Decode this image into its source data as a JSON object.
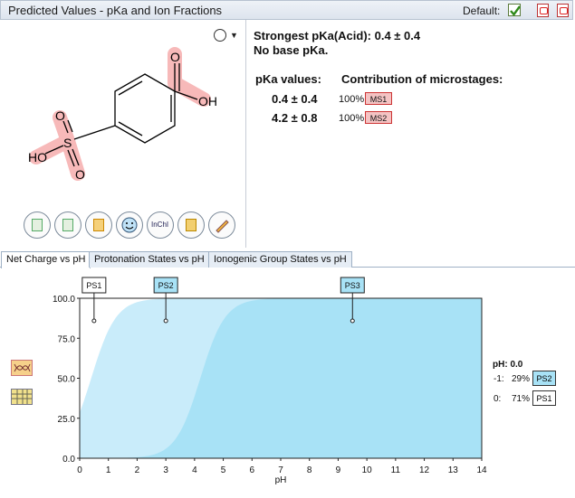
{
  "window": {
    "title": "Predicted Values - pKa and Ion Fractions",
    "default_label": "Default:",
    "default_checked": true
  },
  "molecule": {
    "atoms": [
      "O",
      "OH",
      "HO",
      "S",
      "O",
      "O"
    ],
    "highlight_color": "#f7b9b9",
    "toolbar_buttons": [
      "copy-structure",
      "copy-image",
      "edit-structure",
      "smiley",
      "InChI",
      "open",
      "pencil"
    ],
    "inchi_label": "InChI"
  },
  "pka": {
    "strongest": "Strongest pKa(Acid): 0.4 ± 0.4",
    "no_base": "No base pKa.",
    "header_values": "pKa values:",
    "header_contrib": "Contribution of microstages:",
    "rows": [
      {
        "value": "0.4 ± 0.4",
        "percent": "100%",
        "ms": "MS1"
      },
      {
        "value": "4.2 ± 0.8",
        "percent": "100%",
        "ms": "MS2"
      }
    ]
  },
  "tabs": [
    {
      "label": "Net Charge vs pH",
      "active": true
    },
    {
      "label": "Protonation States vs pH",
      "active": false
    },
    {
      "label": "Ionogenic Group States vs pH",
      "active": false
    }
  ],
  "chart_data": {
    "type": "area",
    "xlabel": "pH",
    "ylabel": "",
    "xlim": [
      0,
      14
    ],
    "ylim": [
      0,
      100
    ],
    "x_ticks": [
      "0",
      "1",
      "2",
      "3",
      "4",
      "5",
      "6",
      "7",
      "8",
      "9",
      "10",
      "11",
      "12",
      "13",
      "14"
    ],
    "y_ticks": [
      "0.0",
      "25.0",
      "50.0",
      "75.0",
      "100.0"
    ],
    "markers": [
      {
        "label": "PS1",
        "ph": 0.5
      },
      {
        "label": "PS2",
        "ph": 3.0
      },
      {
        "label": "PS3",
        "ph": 9.5
      }
    ],
    "series": [
      {
        "color": "#c9ecfa",
        "pka": 0.4
      },
      {
        "color": "#a8e2f6",
        "pka": 4.2
      }
    ],
    "legend": {
      "title": "pH: 0.0",
      "items": [
        {
          "charge": "-1:",
          "percent": "29%",
          "state": "PS2",
          "color": "#a8e2f6"
        },
        {
          "charge": "0:",
          "percent": "71%",
          "state": "PS1",
          "color": "#ffffff"
        }
      ]
    }
  }
}
